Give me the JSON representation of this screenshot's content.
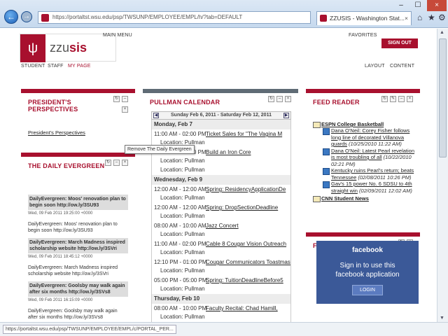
{
  "browser": {
    "url": "https://portaltst.wsu.edu/psp/TWSUNP/EMPLOYEE/EMPL/h/?tab=DEFAULT",
    "tab_title": "ZZUSIS - Washington Stat...",
    "tab_close": "×",
    "win_min": "–",
    "win_max": "☐",
    "win_close": "×",
    "back": "←",
    "forward": "→",
    "status_url": "https://portaltst.wsu.edu/psp/TWSUNP/EMPLOYEE/EMPL/c/PORTAL_PER..."
  },
  "header": {
    "logo_prefix": "zzu",
    "logo_suffix": "sis",
    "main_menu": "MAIN MENU",
    "favorites": "FAVORITES",
    "sign_out": "SIGN OUT",
    "nav": [
      "STUDENT",
      "STAFF",
      "MY PAGE"
    ],
    "layout": "LAYOUT",
    "content": "CONTENT"
  },
  "perspectives": {
    "title_line1": "PRESIDENT'S",
    "title_line2": "PERSPECTIVES",
    "link": "President's Perspectives"
  },
  "evergreen": {
    "title": "THE DAILY EVERGREEN",
    "tooltip": "Remove The Daily Evergreen",
    "items": [
      {
        "title": "DailyEvergreen: Moos' renovation plan to begin soon http://ow.ly/3SU93",
        "date": "Wed, 09 Feb 2011 19:25:00 +0000",
        "body": "DailyEvergreen: Moos' renovation plan to begin soon http://ow.ly/3SU93"
      },
      {
        "title": "DailyEvergreen: March Madness inspired scholarship website http://ow.ly/3SVri",
        "date": "Wed, 09 Feb 2011 18:45:12 +0000",
        "body": "DailyEvergreen: March Madness inspired scholarship website http://ow.ly/3SVri"
      },
      {
        "title": "DailyEvergreen: Goolsby may walk again after six months http://ow.ly/3SVs8",
        "date": "Wed, 09 Feb 2011 16:15:09 +0000",
        "body": "DailyEvergreen: Goolsby may walk again after six months http://ow.ly/3SVs8"
      }
    ]
  },
  "calendar": {
    "title": "PULLMAN CALENDAR",
    "range": "Sunday Feb 6, 2011 - Saturday Feb 12, 2011",
    "prev": "◀",
    "next": "▶",
    "location": "Location: Pullman",
    "days": [
      {
        "label": "Monday, Feb 7",
        "events": [
          {
            "time": "11:00 AM - 02:00 PM",
            "title": "Ticket Sales for \"The Vagina M"
          },
          {
            "time": "11:00 AM - 01:00 PM",
            "title": "Build an Iron Core"
          },
          {
            "time": "",
            "title": ""
          }
        ]
      },
      {
        "label": "Wednesday, Feb 9",
        "events": [
          {
            "time": "12:00 AM - 12:00 AM",
            "title": "Spring: ResidencyApplicationDe"
          },
          {
            "time": "12:00 AM - 12:00 AM",
            "title": "Spring: DropSectionDeadline"
          },
          {
            "time": "08:00 AM - 10:00 AM",
            "title": "Jazz Concert"
          },
          {
            "time": "11:00 AM - 02:00 PM",
            "title": "Cable 8 Cougar Vision Outreach"
          },
          {
            "time": "12:10 PM - 01:00 PM",
            "title": "Cougar Communicators Toastmast"
          },
          {
            "time": "05:00 PM - 05:00 PM",
            "title": "Spring: TuitionDeadlineBefore5"
          }
        ]
      },
      {
        "label": "Thursday, Feb 10",
        "events": [
          {
            "time": "08:00 AM - 10:00 PM",
            "title": "Faculty Recital: Chad Hamill,"
          }
        ]
      }
    ]
  },
  "feed": {
    "title": "FEED READER",
    "source": "ESPN College Basketball",
    "items": [
      {
        "text": "Dana O'Neil: Corey Fisher follows long line of decorated Villanova guards",
        "date": "(10/25/2010 11:22 AM)"
      },
      {
        "text": "Dana O'Neil: Latest Pearl revelation is most troubling of all",
        "date": "(10/22/2010 02:21 PM)"
      },
      {
        "text": "Kentucky ruins Pearl's return; beats Tennessee",
        "date": "(02/08/2011 10:26 PM)"
      },
      {
        "text": "Gav's 15 power No. 6 SDSU to 4th straight win",
        "date": "(02/09/2011 12:02 AM)"
      }
    ],
    "source2": "CNN Student News"
  },
  "facebook": {
    "title": "FACEBOOK",
    "brand": "facebook",
    "msg_line1": "Sign in to use this",
    "msg_line2": "facebook application",
    "login": "LOGIN"
  },
  "colors": {
    "brand": "#a8102e",
    "facebook": "#3b5998"
  }
}
